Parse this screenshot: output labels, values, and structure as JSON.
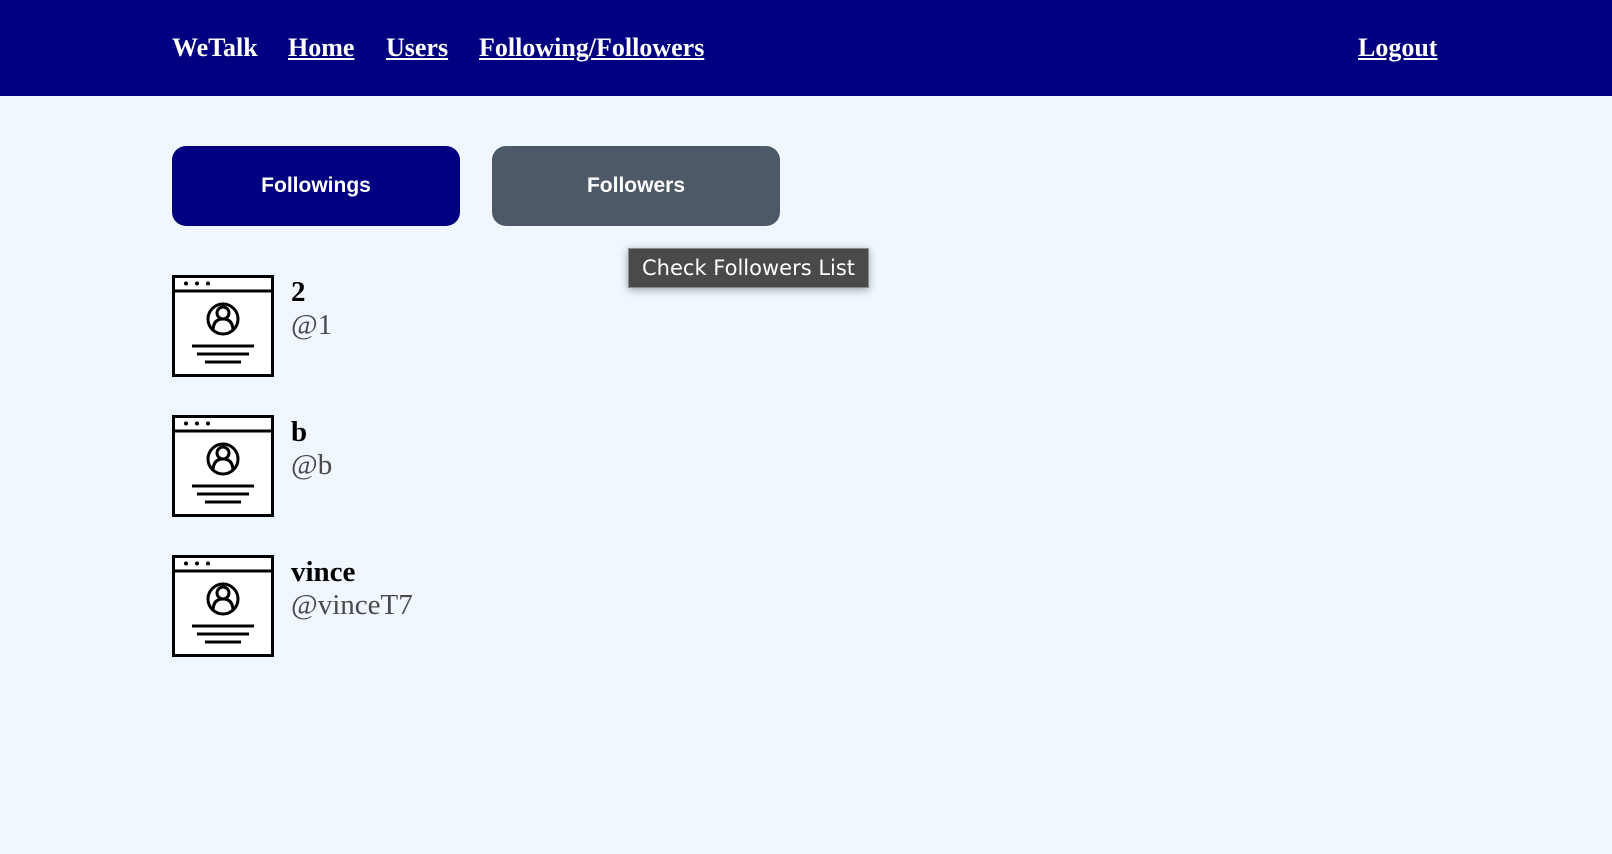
{
  "navbar": {
    "brand": "WeTalk",
    "links": [
      "Home",
      "Users",
      "Following/Followers"
    ],
    "logout": "Logout",
    "background_color": "#000080"
  },
  "tabs": {
    "followings_label": "Followings",
    "followers_label": "Followers",
    "active_color": "#000080",
    "inactive_color": "#4d5966"
  },
  "tooltip": {
    "text": "Check Followers List"
  },
  "users": [
    {
      "name": "2",
      "handle": "@1",
      "avatar_icon": "profile-page-icon"
    },
    {
      "name": "b",
      "handle": "@b",
      "avatar_icon": "profile-page-icon"
    },
    {
      "name": "vince",
      "handle": "@vinceT7",
      "avatar_icon": "profile-page-icon"
    }
  ]
}
